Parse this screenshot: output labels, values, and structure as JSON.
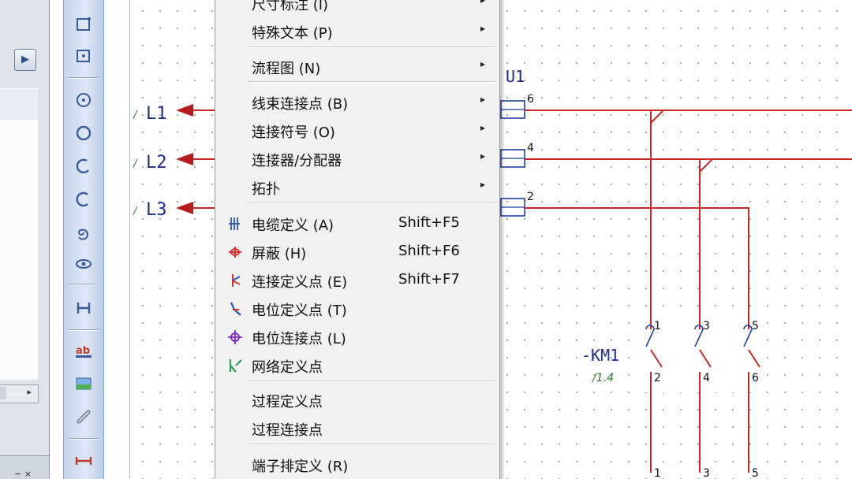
{
  "left_panel": {
    "scroll_arrow_icon": "arrow-right-icon",
    "bottom_hint": "− ×"
  },
  "toolbar": {
    "tools": [
      "rectangle-icon",
      "rectangle-point-icon",
      "circle-point-icon",
      "circle-icon",
      "arc-icon",
      "arc-open-icon",
      "spiral-icon",
      "eye-icon",
      "dimension-icon",
      "text-ab-icon",
      "image-icon",
      "link-icon",
      "measure-icon"
    ]
  },
  "schematic": {
    "source_labels": [
      "L1",
      "L2",
      "L3"
    ],
    "component": "U1",
    "pins": [
      "6",
      "4",
      "2"
    ],
    "contactor": {
      "name": "-KM1",
      "ref": "/1.4",
      "top_terminals": [
        "1",
        "3",
        "5"
      ],
      "bottom_terminals": [
        "2",
        "4",
        "6"
      ],
      "lower_terminals": [
        "1",
        "3",
        "5"
      ]
    },
    "colors": {
      "wire": "#c62828",
      "arrow": "#b71c1c",
      "label": "#1f2a8c",
      "ref": "#2e7d32",
      "pin_box": "#1f3fa3"
    }
  },
  "context_menu": {
    "items": [
      {
        "label": "尺寸标注 (I)",
        "shortcut": "",
        "submenu": true,
        "icon": ""
      },
      {
        "label": "特殊文本 (P)",
        "shortcut": "",
        "submenu": true,
        "icon": ""
      },
      {
        "label": "流程图 (N)",
        "shortcut": "",
        "submenu": true,
        "icon": ""
      },
      {
        "label": "线束连接点 (B)",
        "shortcut": "",
        "submenu": true,
        "icon": ""
      },
      {
        "label": "连接符号 (O)",
        "shortcut": "",
        "submenu": true,
        "icon": ""
      },
      {
        "label": "连接器/分配器",
        "shortcut": "",
        "submenu": true,
        "icon": ""
      },
      {
        "label": "拓扑",
        "shortcut": "",
        "submenu": true,
        "icon": ""
      },
      {
        "label": "电缆定义 (A)",
        "shortcut": "Shift+F5",
        "submenu": false,
        "icon": "cable-definition-icon"
      },
      {
        "label": "屏蔽 (H)",
        "shortcut": "Shift+F6",
        "submenu": false,
        "icon": "shield-icon"
      },
      {
        "label": "连接定义点 (E)",
        "shortcut": "Shift+F7",
        "submenu": false,
        "icon": "connection-point-icon"
      },
      {
        "label": "电位定义点 (T)",
        "shortcut": "",
        "submenu": false,
        "icon": "potential-definition-icon"
      },
      {
        "label": "电位连接点 (L)",
        "shortcut": "",
        "submenu": false,
        "icon": "potential-connection-icon"
      },
      {
        "label": "网络定义点",
        "shortcut": "",
        "submenu": false,
        "icon": "network-definition-icon"
      },
      {
        "label": "过程定义点",
        "shortcut": "",
        "submenu": false,
        "icon": ""
      },
      {
        "label": "过程连接点",
        "shortcut": "",
        "submenu": false,
        "icon": ""
      },
      {
        "label": "端子排定义 (R)",
        "shortcut": "",
        "submenu": false,
        "icon": ""
      }
    ],
    "submenu_arrow": "▸"
  }
}
